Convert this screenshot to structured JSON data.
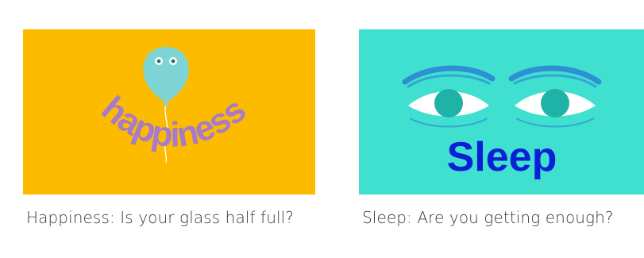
{
  "colors": {
    "happiness_bg": "#FDBB00",
    "happiness_text": "#A77BC9",
    "balloon": "#7FD4D6",
    "sleep_bg": "#3FE0D0",
    "sleep_text": "#0B1FD6",
    "eye_iris": "#1FB3A8",
    "eye_outline": "#2E8FD3",
    "caption": "#3a3a3a"
  },
  "cards": [
    {
      "image_text": "happiness",
      "title": "Happiness: Is your glass half full?",
      "icon": "balloon-icon"
    },
    {
      "image_text": "Sleep",
      "title": "Sleep: Are you getting enough?",
      "icon": "eyes-icon"
    }
  ]
}
